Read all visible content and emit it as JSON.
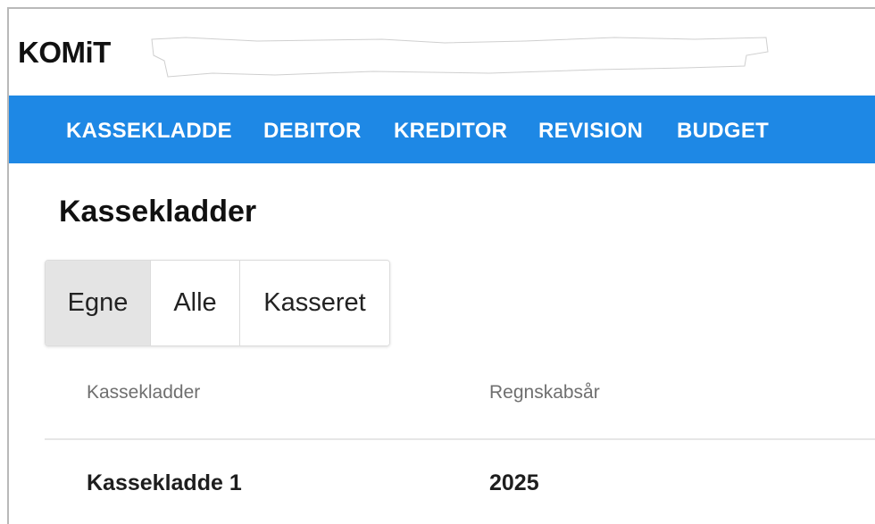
{
  "header": {
    "logo_text": "KOMiT"
  },
  "nav": {
    "items": [
      {
        "label": "KASSEKLADDE"
      },
      {
        "label": "DEBITOR"
      },
      {
        "label": "KREDITOR"
      },
      {
        "label": "REVISION"
      },
      {
        "label": "BUDGET"
      }
    ],
    "background_color": "#1e88e5"
  },
  "main": {
    "title": "Kassekladder",
    "filter_tabs": [
      {
        "label": "Egne",
        "selected": true
      },
      {
        "label": "Alle",
        "selected": false
      },
      {
        "label": "Kasseret",
        "selected": false
      }
    ],
    "table": {
      "columns": [
        "Kassekladder",
        "Regnskabsår"
      ],
      "rows": [
        [
          "Kassekladde 1",
          "2025"
        ]
      ]
    }
  }
}
